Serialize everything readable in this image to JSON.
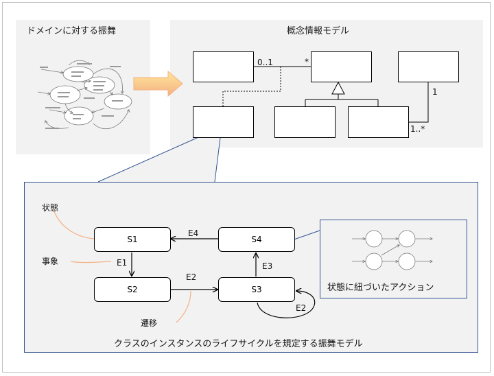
{
  "left_panel": {
    "title": "ドメインに対する振舞"
  },
  "right_panel": {
    "title": "概念情報モデル",
    "multiplicities": {
      "zero_to_one": "0..1",
      "many_top": "*",
      "one": "1",
      "one_to_many": "1..*"
    }
  },
  "bottom_panel": {
    "states": {
      "s1": "S1",
      "s2": "S2",
      "s3": "S3",
      "s4": "S4"
    },
    "events": {
      "e1": "E1",
      "e2_top": "E2",
      "e2_loop": "E2",
      "e3": "E3",
      "e4": "E4"
    },
    "annotations": {
      "state": "状態",
      "event": "事象",
      "transition": "遷移"
    },
    "action_box_caption": "状態に紐づいたアクション",
    "caption": "クラスのインスタンスのライフサイクルを規定する振舞モデル"
  }
}
